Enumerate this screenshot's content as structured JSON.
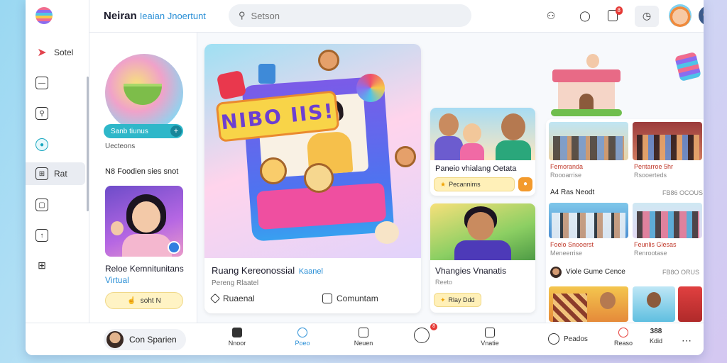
{
  "header": {
    "title": "Neiran",
    "subtitle": "Ieaian Jnoertunt",
    "search_placeholder": "Setson",
    "notification_badge": "8"
  },
  "rail": {
    "items": [
      {
        "label": "Sotel",
        "icon": "arrow-icon"
      },
      {
        "label": "",
        "icon": "note-icon"
      },
      {
        "label": "",
        "icon": "doc-search-icon"
      },
      {
        "label": "",
        "icon": "circle-logo-icon"
      },
      {
        "label": "Rat",
        "icon": "grid-icon"
      },
      {
        "label": "",
        "icon": "calendar-icon"
      },
      {
        "label": "",
        "icon": "bookmark-icon"
      },
      {
        "label": "",
        "icon": "apps-icon"
      }
    ]
  },
  "left": {
    "pill_label": "Sanb tiunus",
    "caption": "Uecteons",
    "section_title": "N8 Foodien sies snot",
    "card_title": "Reloe Kemnitunitans",
    "card_link": "Virtual",
    "button_label": "soht N"
  },
  "hero": {
    "sign_text": "NIBO IIS!",
    "title": "Ruang Kereonossial",
    "title_tag": "Kaanel",
    "sub": "Pereng Rlaatel",
    "action_left": "Ruaenal",
    "action_right": "Comuntam"
  },
  "cards": [
    {
      "title": "Paneio vhialang Oetata",
      "button": "Pecannims"
    },
    {
      "title": "Vhangies Vnanatis",
      "sub": "Reeto",
      "button": "Rlay Ddd"
    }
  ],
  "right": {
    "labels_top": [
      "Femoranda",
      "Pentarroe 5hr"
    ],
    "subs_top": [
      "Roooarrise",
      "Rsooerteds"
    ],
    "head_a": "A4 Ras Neodt",
    "head_a_right": "FB86 OCOUS",
    "labels_mid": [
      "Foelo Snooerst",
      "Feunlis Glesas"
    ],
    "subs_mid": [
      "Meneerrise",
      "Renrootase"
    ],
    "head_b": "Viole Gume Cence",
    "head_b_right": "FB8O ORUS"
  },
  "bottom": {
    "user": "Con Sparien",
    "nav": [
      {
        "label": "Nnoor"
      },
      {
        "label": "Poeo"
      },
      {
        "label": "Neuen"
      },
      {
        "label": "",
        "badge": "8"
      },
      {
        "label": "Vnatie"
      },
      {
        "label": "Peados"
      },
      {
        "label": "Reaso"
      },
      {
        "label": "Kdid",
        "icon_text": "388"
      }
    ]
  },
  "colors": {
    "accent": "#2a8fd6",
    "badge": "#e53935",
    "pill": "#2eb7c9",
    "button_yellow": "#fff3c4"
  }
}
